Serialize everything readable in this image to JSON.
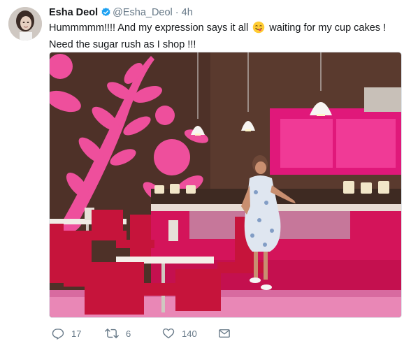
{
  "tweet": {
    "author_name": "Esha Deol",
    "author_handle": "@Esha_Deol",
    "separator": "·",
    "time_ago": "4h",
    "text_line1_a": "Hummmmm!!!! And my expression says it all ",
    "text_line1_b": " waiting for my cup cakes !",
    "text_line2": "Need the sugar rush as I shop !!!",
    "emoji_icon": "savoring-face-icon"
  },
  "actions": {
    "reply_count": "17",
    "retweet_count": "6",
    "like_count": "140"
  },
  "colors": {
    "verified": "#1da1f2",
    "meta_gray": "#657786",
    "wall_pink": "#ee4f9c",
    "counter_magenta": "#d4145a",
    "wall_brown": "#5a3a2e"
  }
}
